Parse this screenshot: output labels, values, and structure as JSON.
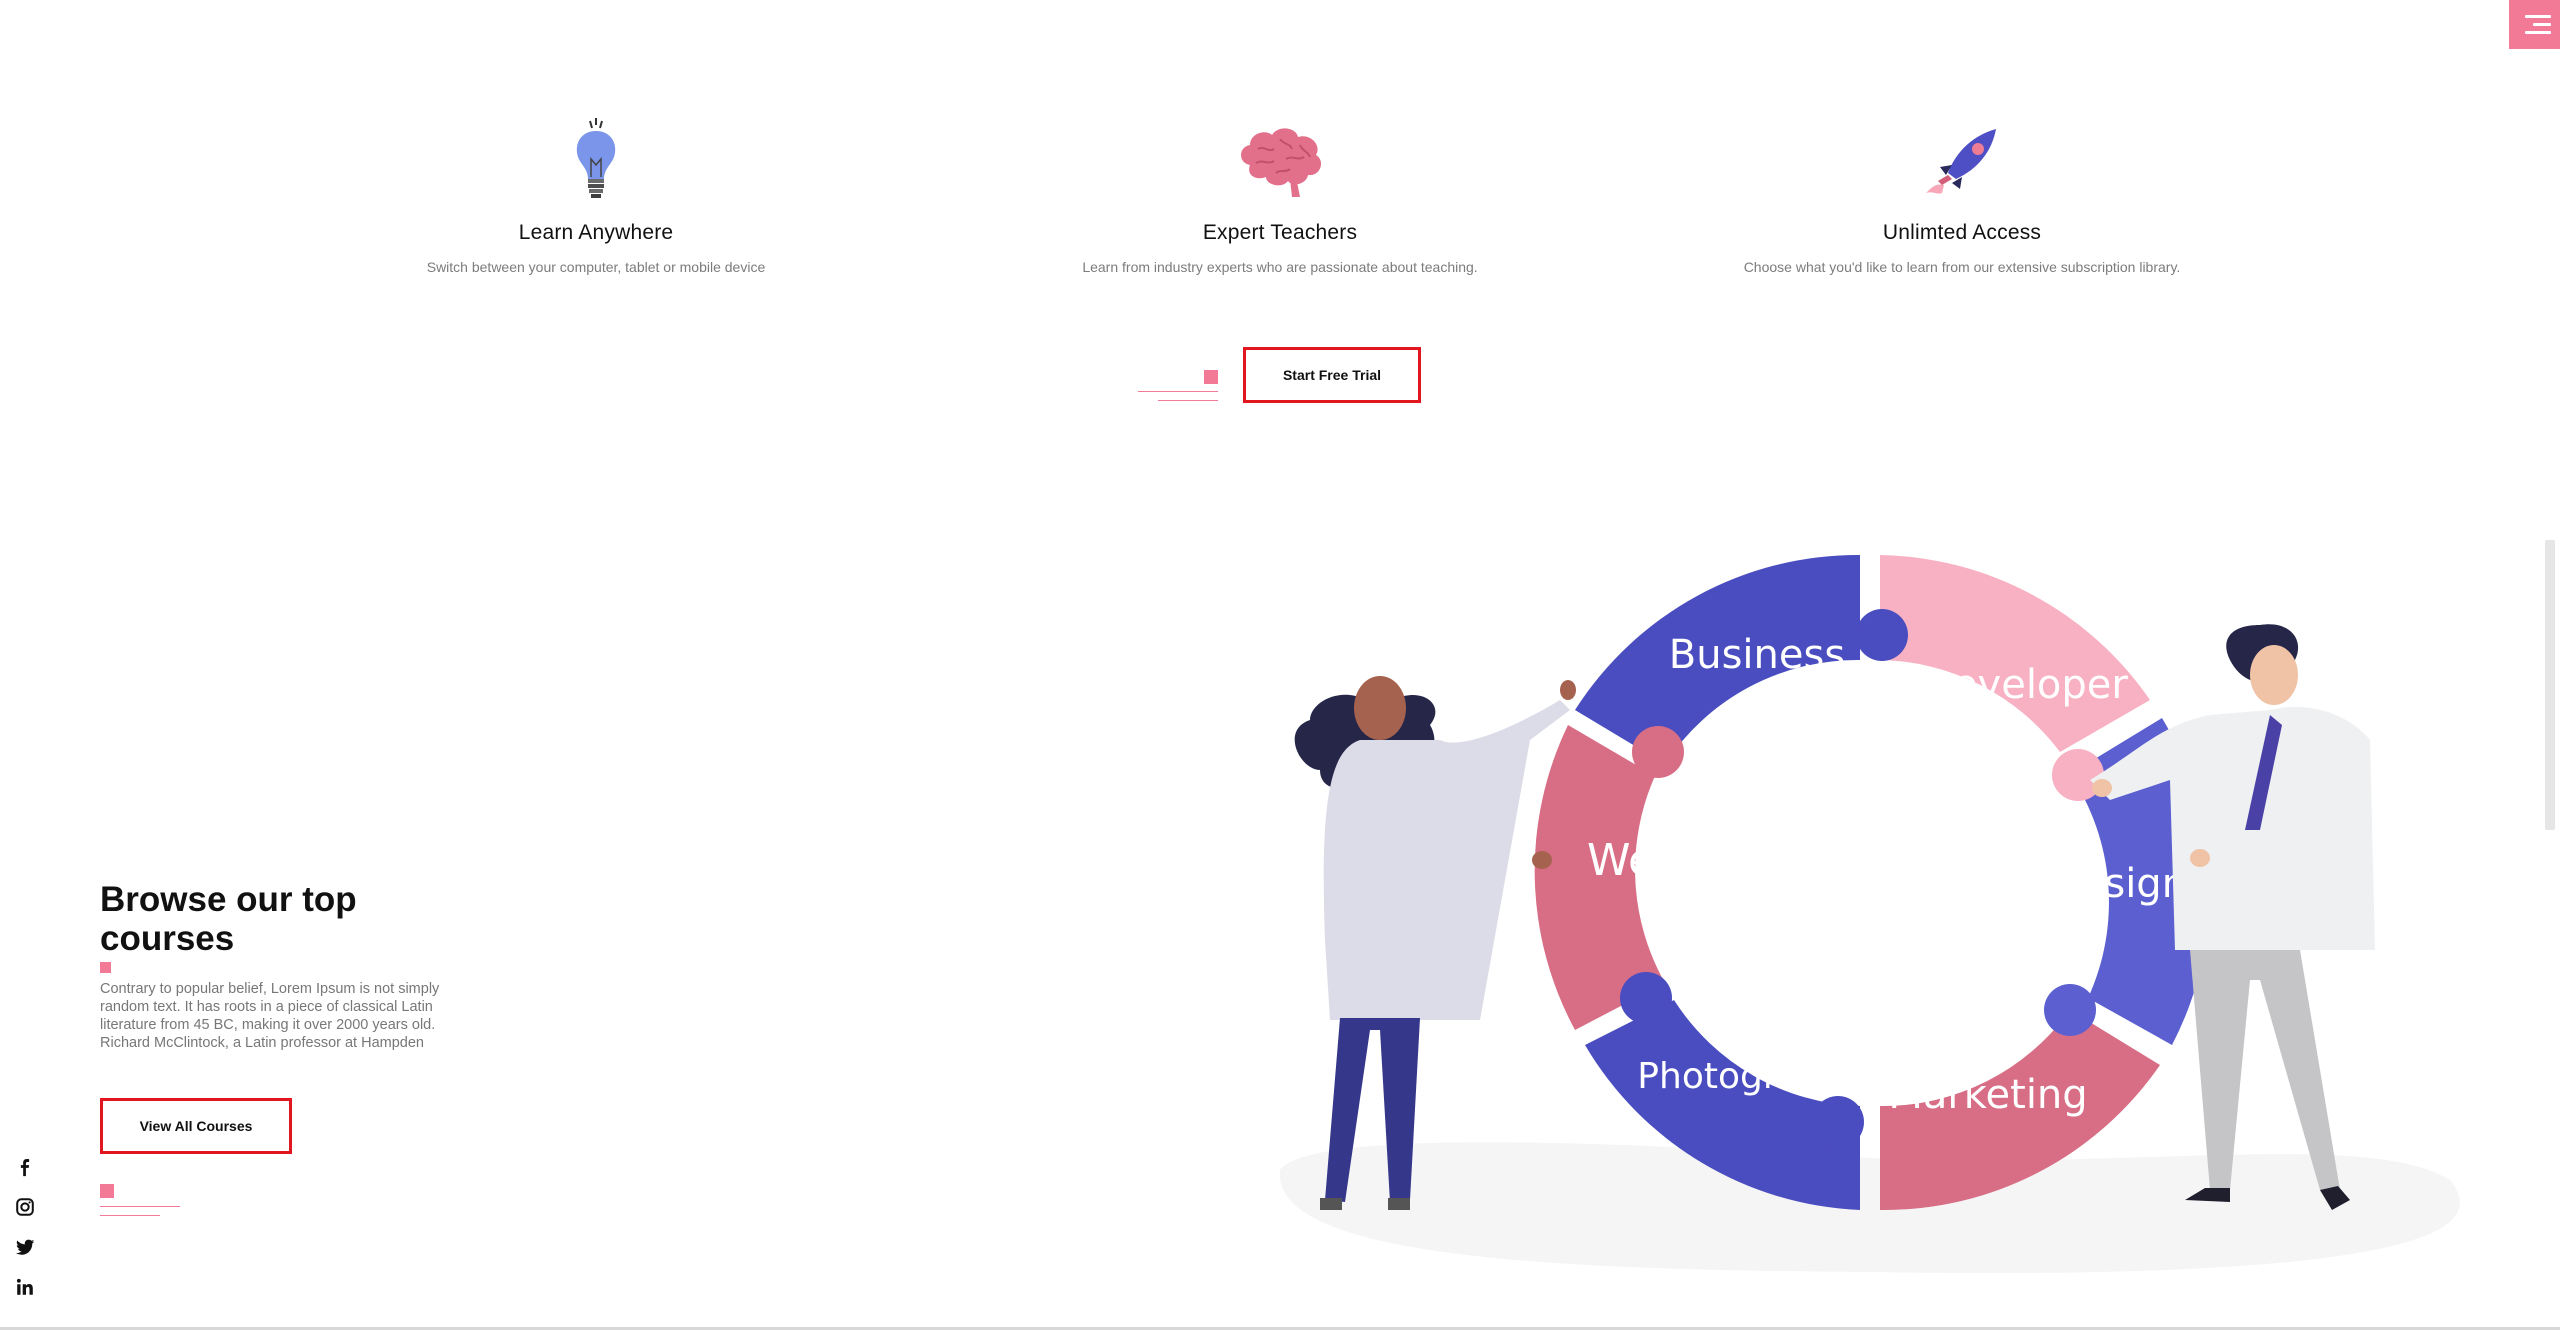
{
  "menu": {
    "icon": "hamburger-menu-icon",
    "color": "#f27a97"
  },
  "features": [
    {
      "icon": "lightbulb-icon",
      "title": "Learn Anywhere",
      "text": "Switch between your computer, tablet or mobile device"
    },
    {
      "icon": "brain-icon",
      "title": "Expert Teachers",
      "text": "Learn from industry experts who are passionate about teaching."
    },
    {
      "icon": "rocket-icon",
      "title": "Unlimted Access",
      "text": "Choose what you'd like to learn from our extensive subscription library."
    }
  ],
  "trial_button": {
    "label": "Start Free Trial"
  },
  "courses": {
    "title": "Browse our top courses",
    "text": "Contrary to popular belief, Lorem Ipsum is not simply random text. It has roots in a piece of classical Latin literature from 45 BC, making it over 2000 years old. Richard McClintock, a Latin professor at Hampden",
    "button_label": "View All Courses"
  },
  "illustration": {
    "segments": [
      "Business",
      "Developer",
      "Design",
      "Marketing",
      "Photography",
      "Web"
    ]
  },
  "social": [
    "facebook-icon",
    "instagram-icon",
    "twitter-icon",
    "linkedin-icon"
  ],
  "colors": {
    "accent": "#f27a97",
    "button_border": "#e2161e",
    "blue": "#4a4dbf",
    "pink_light": "#f8b1c2",
    "rose": "#d86e85",
    "violet": "#5b5fcf"
  }
}
